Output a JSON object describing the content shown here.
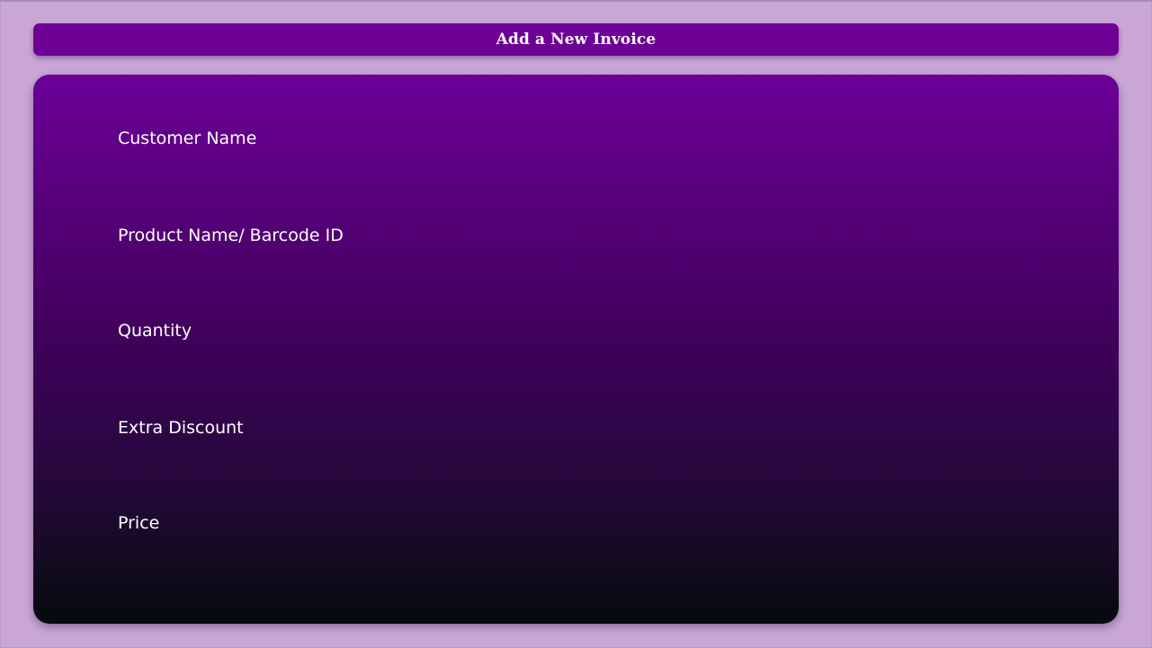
{
  "header": {
    "title": "Add a New Invoice"
  },
  "form": {
    "fields": [
      {
        "label": "Customer Name",
        "value": ""
      },
      {
        "label": "Product Name/ Barcode ID",
        "value": ""
      },
      {
        "label": "Quantity",
        "value": ""
      },
      {
        "label": "Extra Discount",
        "value": ""
      },
      {
        "label": "Price",
        "value": ""
      }
    ]
  },
  "colors": {
    "background": "#c9a6d6",
    "header_bar": "#6e0096",
    "card_top": "#6c0098",
    "card_bottom": "#060a0e",
    "text": "#ffffff"
  }
}
